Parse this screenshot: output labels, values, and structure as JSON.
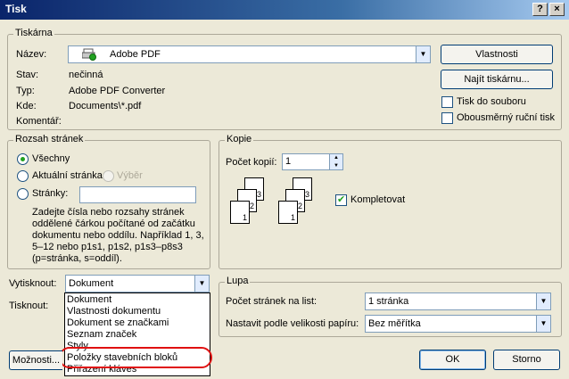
{
  "window": {
    "title": "Tisk",
    "help_label": "?",
    "close_label": "×"
  },
  "printer": {
    "group_label": "Tiskárna",
    "name_label": "Název:",
    "name_value": "Adobe PDF",
    "status_label": "Stav:",
    "status_value": "nečinná",
    "type_label": "Typ:",
    "type_value": "Adobe PDF Converter",
    "where_label": "Kde:",
    "where_value": "Documents\\*.pdf",
    "comment_label": "Komentář:",
    "properties_button": "Vlastnosti",
    "find_printer_button": "Najít tiskárnu...",
    "print_to_file_label": "Tisk do souboru",
    "print_to_file_checked": false,
    "duplex_label": "Obousměrný ruční tisk",
    "duplex_checked": false
  },
  "page_range": {
    "group_label": "Rozsah stránek",
    "all_label": "Všechny",
    "current_label": "Aktuální stránka",
    "selection_label": "Výběr",
    "pages_label": "Stránky:",
    "pages_value": "",
    "hint": "Zadejte čísla nebo rozsahy stránek oddělené čárkou počítané od začátku dokumentu nebo oddílu. Například 1, 3, 5–12 nebo p1s1, p1s2, p1s3–p8s3 (p=stránka, s=oddíl).",
    "selected": "all"
  },
  "copies": {
    "group_label": "Kopie",
    "count_label": "Počet kopií:",
    "count_value": "1",
    "collate_label": "Kompletovat",
    "collate_checked": true,
    "page_numbers": [
      "1",
      "2",
      "3"
    ]
  },
  "print_what": {
    "label": "Vytisknout:",
    "value": "Dokument",
    "options": [
      "Dokument",
      "Vlastnosti dokumentu",
      "Dokument se značkami",
      "Seznam značek",
      "Styly",
      "Položky stavebních bloků",
      "Přiřazení kláves"
    ],
    "highlighted_option": "Položky stavebních bloků"
  },
  "print_label": "Tisknout:",
  "zoom": {
    "group_label": "Lupa",
    "pages_per_sheet_label": "Počet stránek na list:",
    "pages_per_sheet_value": "1 stránka",
    "scale_label": "Nastavit podle velikosti papíru:",
    "scale_value": "Bez měřítka"
  },
  "footer": {
    "options_button": "Možnosti...",
    "ok_button": "OK",
    "cancel_button": "Storno"
  },
  "colors": {
    "title_start": "#0a246a",
    "title_end": "#a6caf0",
    "highlight_ring": "#e01010",
    "check_green": "#21a121"
  }
}
